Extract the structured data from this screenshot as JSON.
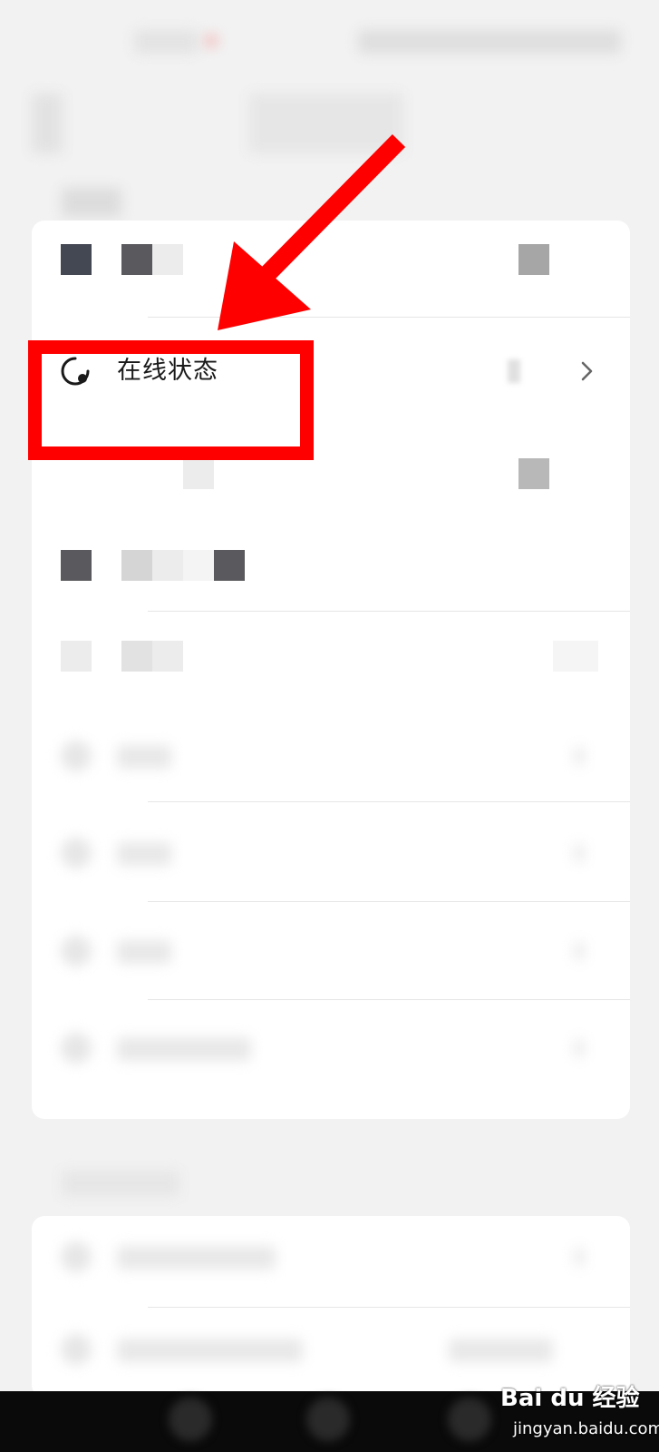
{
  "settings_list": {
    "online_status": {
      "label": "在线状态",
      "icon": "online-status-icon",
      "chevron_icon": "chevron-right-icon"
    }
  },
  "watermark": {
    "brand": "Bai du 经验",
    "url": "jingyan.baidu.com"
  },
  "annotation": {
    "box_color": "#ff0000",
    "arrow_color": "#ff0000"
  },
  "colors": {
    "background": "#f2f2f2",
    "card": "#ffffff",
    "navbar": "#0a0a0a"
  }
}
